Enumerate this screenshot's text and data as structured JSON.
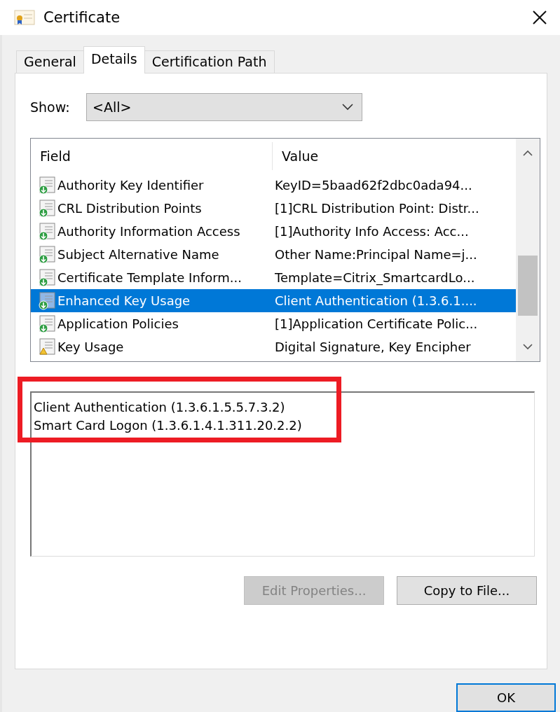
{
  "window": {
    "title": "Certificate"
  },
  "tabs": [
    {
      "label": "General",
      "selected": false
    },
    {
      "label": "Details",
      "selected": true
    },
    {
      "label": "Certification Path",
      "selected": false
    }
  ],
  "show": {
    "label": "Show:",
    "value": "<All>"
  },
  "fields_list": {
    "columns": [
      "Field",
      "Value"
    ],
    "rows": [
      {
        "field": "Authority Key Identifier",
        "value": "KeyID=5baad62f2dbc0ada94...",
        "kind": "extension",
        "selected": false
      },
      {
        "field": "CRL Distribution Points",
        "value": "[1]CRL Distribution Point: Distr...",
        "kind": "extension",
        "selected": false
      },
      {
        "field": "Authority Information Access",
        "value": "[1]Authority Info Access: Acc...",
        "kind": "extension",
        "selected": false
      },
      {
        "field": "Subject Alternative Name",
        "value": "Other Name:Principal Name=j...",
        "kind": "extension",
        "selected": false
      },
      {
        "field": "Certificate Template Inform...",
        "value": "Template=Citrix_SmartcardLo...",
        "kind": "extension",
        "selected": false
      },
      {
        "field": "Enhanced Key Usage",
        "value": "Client Authentication (1.3.6.1....",
        "kind": "extension",
        "selected": true
      },
      {
        "field": "Application Policies",
        "value": "[1]Application Certificate Polic...",
        "kind": "extension",
        "selected": false
      },
      {
        "field": "Key Usage",
        "value": "Digital Signature, Key Encipher",
        "kind": "critical",
        "selected": false
      }
    ]
  },
  "detail_lines": [
    "Client Authentication (1.3.6.1.5.5.7.3.2)",
    "Smart Card Logon (1.3.6.1.4.1.311.20.2.2)"
  ],
  "buttons": [
    {
      "label": "Edit Properties...",
      "disabled": true
    },
    {
      "label": "Copy to File...",
      "disabled": false
    }
  ],
  "ok_button": {
    "label": "OK",
    "default": true
  }
}
